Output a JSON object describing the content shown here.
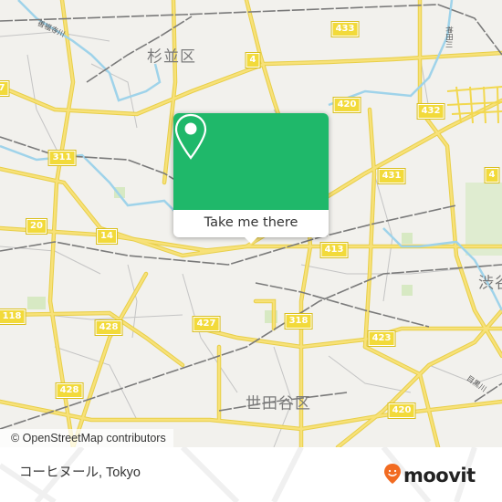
{
  "map": {
    "attribution": "© OpenStreetMap contributors",
    "ward_labels": [
      {
        "id": "suginami",
        "text": "杉並区"
      },
      {
        "id": "setagaya",
        "text": "世田谷区"
      },
      {
        "id": "shibuya",
        "text": "渋谷"
      }
    ],
    "river_labels": [
      {
        "id": "zenpukuji",
        "text": "善福寺川"
      },
      {
        "id": "kandagawa",
        "text": "神田川"
      },
      {
        "id": "meguro",
        "text": "目黒川"
      }
    ],
    "route_shields": [
      {
        "id": "r433",
        "text": "433"
      },
      {
        "id": "r4a",
        "text": "4"
      },
      {
        "id": "r420a",
        "text": "420"
      },
      {
        "id": "r432",
        "text": "432"
      },
      {
        "id": "r311",
        "text": "311"
      },
      {
        "id": "r431",
        "text": "431"
      },
      {
        "id": "r4b",
        "text": "4"
      },
      {
        "id": "r20",
        "text": "20"
      },
      {
        "id": "r14",
        "text": "14"
      },
      {
        "id": "r413",
        "text": "413"
      },
      {
        "id": "r118",
        "text": "118"
      },
      {
        "id": "r428a",
        "text": "428"
      },
      {
        "id": "r427",
        "text": "427"
      },
      {
        "id": "r318",
        "text": "318"
      },
      {
        "id": "r423",
        "text": "423"
      },
      {
        "id": "r428b",
        "text": "428"
      },
      {
        "id": "r420b",
        "text": "420"
      },
      {
        "id": "r7",
        "text": "7"
      }
    ],
    "colors": {
      "land": "#f2f1ed",
      "road_major": "#f5dc5a",
      "road_minor": "#b5b5b5",
      "rail": "#777777",
      "river": "#8fcde8",
      "park": "#cfe6b5"
    }
  },
  "popup": {
    "icon": "map-pin-icon",
    "action_label": "Take me there",
    "color": "#1fb86a"
  },
  "footer": {
    "title": "コーヒヌール, Tokyo",
    "brand": "moovit",
    "brand_color": "#f26b21"
  }
}
